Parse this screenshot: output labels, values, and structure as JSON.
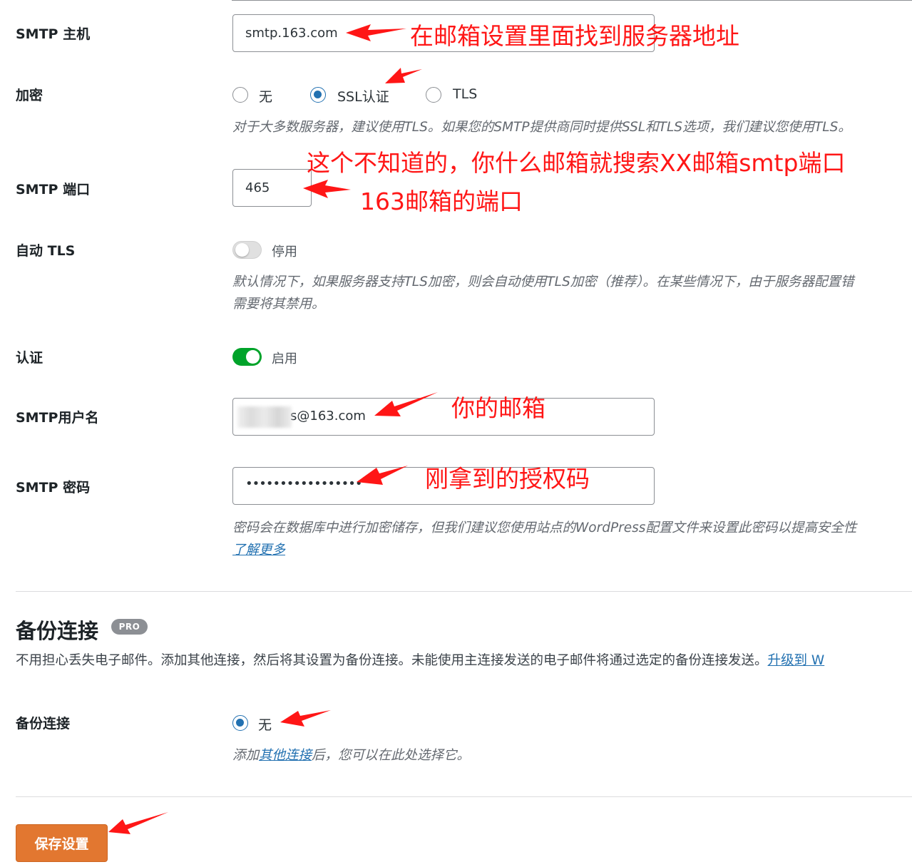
{
  "fields": {
    "smtp_host": {
      "label": "SMTP 主机",
      "value": "smtp.163.com"
    },
    "encryption": {
      "label": "加密",
      "options": [
        "无",
        "SSL认证",
        "TLS"
      ],
      "selected": "SSL认证",
      "description": "对于大多数服务器，建议使用TLS。如果您的SMTP提供商同时提供SSL和TLS选项，我们建议您使用TLS。"
    },
    "smtp_port": {
      "label": "SMTP 端口",
      "value": "465"
    },
    "auto_tls": {
      "label": "自动 TLS",
      "state": "停用",
      "description_line1": "默认情况下，如果服务器支持TLS加密，则会自动使用TLS加密（推荐）。在某些情况下，由于服务器配置错",
      "description_line2": "需要将其禁用。"
    },
    "auth": {
      "label": "认证",
      "state": "启用"
    },
    "smtp_username": {
      "label": "SMTP用户名",
      "value": "s@163.com"
    },
    "smtp_password": {
      "label": "SMTP 密码",
      "value": "•••••••••••••••••",
      "description": "密码会在数据库中进行加密储存，但我们建议您使用站点的WordPress配置文件来设置此密码以提高安全性",
      "learn_more": "了解更多"
    }
  },
  "backup": {
    "title": "备份连接",
    "badge": "PRO",
    "description": "不用担心丢失电子邮件。添加其他连接，然后将其设置为备份连接。未能使用主连接发送的电子邮件将通过选定的备份连接发送。",
    "upgrade_link": "升级到 W",
    "field_label": "备份连接",
    "option_none": "无",
    "hint_prefix": "添加",
    "hint_link": "其他连接",
    "hint_suffix": "后，您可以在此处选择它。"
  },
  "save_button": "保存设置",
  "annotations": {
    "host": "在邮箱设置里面找到服务器地址",
    "port_tip": "这个不知道的，你什么邮箱就搜索XX邮箱smtp端口",
    "port_163": "163邮箱的端口",
    "username": "你的邮箱",
    "password": "刚拿到的授权码"
  },
  "colors": {
    "accent_blue": "#2271b1",
    "toggle_on": "#00a32a",
    "save_button": "#e27730",
    "annotation_red": "#ff1616"
  }
}
